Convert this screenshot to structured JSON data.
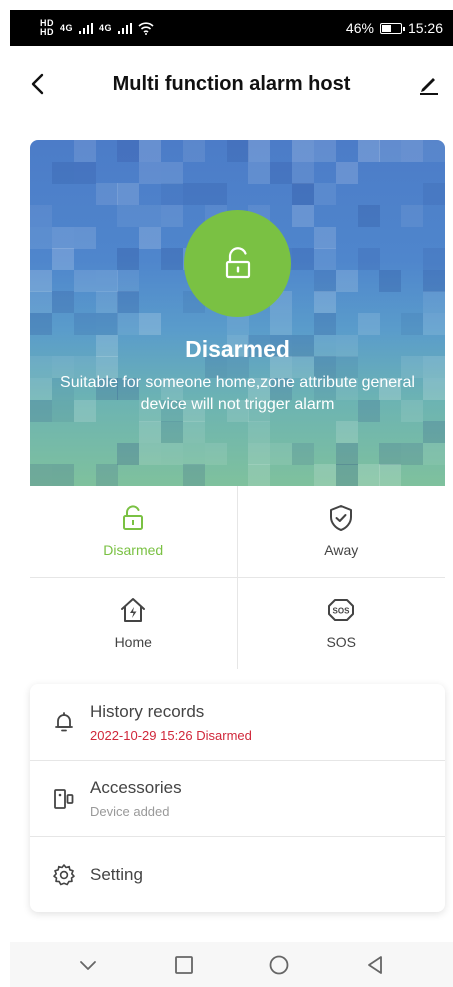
{
  "status_bar": {
    "hd_top": "HD",
    "hd_bottom": "HD",
    "net1": "4G",
    "net2": "4G",
    "battery_percent": "46%",
    "time": "15:26"
  },
  "header": {
    "title": "Multi function alarm host"
  },
  "hero": {
    "state": "Disarmed",
    "description": "Suitable for someone home,zone attribute general device will not trigger alarm",
    "accent_color": "#7ac143"
  },
  "modes": [
    {
      "label": "Disarmed",
      "icon": "unlock-icon",
      "active": true
    },
    {
      "label": "Away",
      "icon": "shield-check-icon",
      "active": false
    },
    {
      "label": "Home",
      "icon": "home-bolt-icon",
      "active": false
    },
    {
      "label": "SOS",
      "icon": "sos-icon",
      "active": false
    }
  ],
  "list": {
    "history": {
      "title": "History records",
      "subtitle": "2022-10-29 15:26 Disarmed"
    },
    "accessories": {
      "title": "Accessories",
      "subtitle": "Device added"
    },
    "setting": {
      "title": "Setting"
    }
  },
  "colors": {
    "active": "#7ac143",
    "alert": "#d0273a"
  }
}
